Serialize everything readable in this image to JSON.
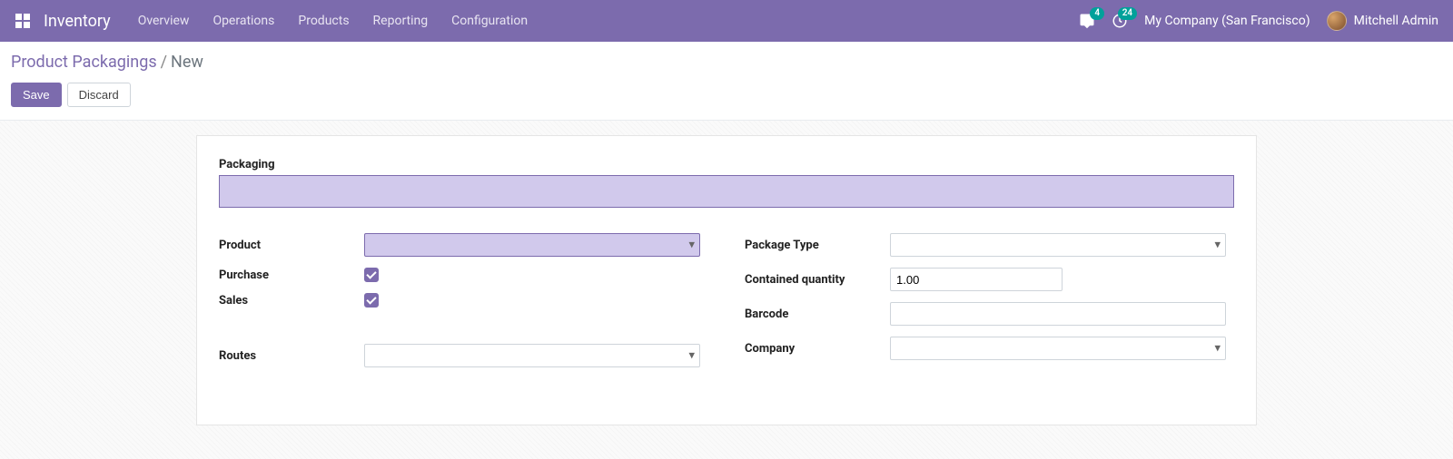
{
  "navbar": {
    "brand": "Inventory",
    "menu": [
      "Overview",
      "Operations",
      "Products",
      "Reporting",
      "Configuration"
    ],
    "messages_badge": "4",
    "activities_badge": "24",
    "company": "My Company (San Francisco)",
    "user": "Mitchell Admin"
  },
  "breadcrumb": {
    "parent": "Product Packagings",
    "sep": "/",
    "current": "New"
  },
  "buttons": {
    "save": "Save",
    "discard": "Discard"
  },
  "form": {
    "packaging_label": "Packaging",
    "packaging_value": "",
    "left": {
      "product_label": "Product",
      "product_value": "",
      "purchase_label": "Purchase",
      "purchase_checked": true,
      "sales_label": "Sales",
      "sales_checked": true,
      "routes_label": "Routes",
      "routes_value": ""
    },
    "right": {
      "package_type_label": "Package Type",
      "package_type_value": "",
      "contained_qty_label": "Contained quantity",
      "contained_qty_value": "1.00",
      "barcode_label": "Barcode",
      "barcode_value": "",
      "company_label": "Company",
      "company_value": ""
    }
  }
}
